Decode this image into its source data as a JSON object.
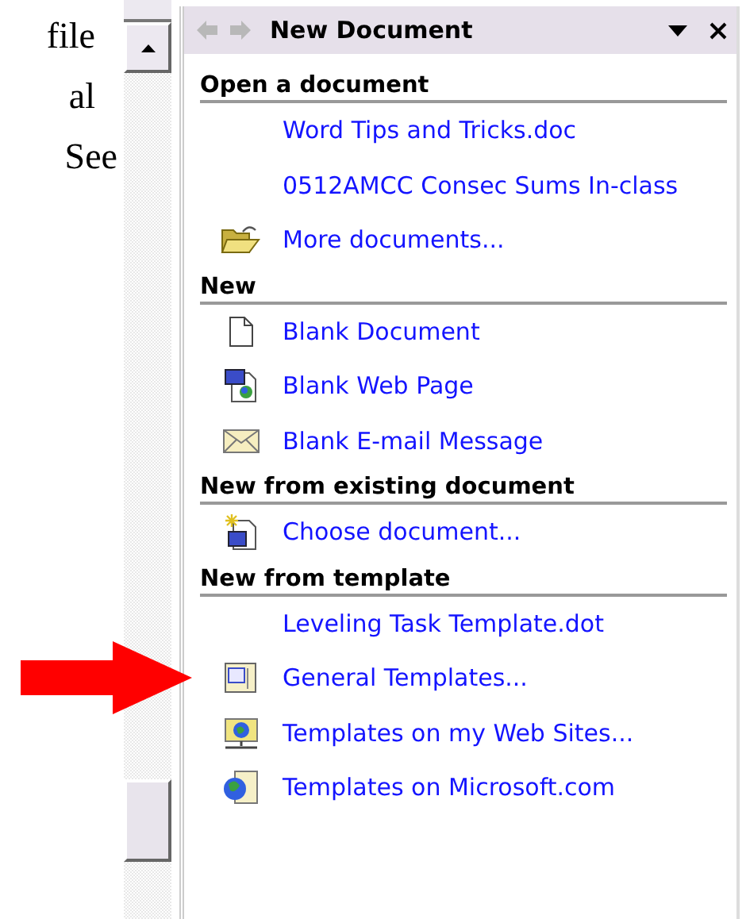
{
  "side_text": [
    "file",
    "al",
    "See"
  ],
  "pane": {
    "title": "New Document",
    "back_disabled": true,
    "forward_disabled": true,
    "sections": [
      {
        "heading": "Open a document",
        "items": [
          {
            "label": "Word Tips and Tricks.doc",
            "kind": "recent"
          },
          {
            "label": "0512AMCC Consec Sums In-class",
            "kind": "recent"
          },
          {
            "label": "More documents...",
            "kind": "folder"
          }
        ]
      },
      {
        "heading": "New",
        "items": [
          {
            "label": "Blank Document",
            "kind": "page"
          },
          {
            "label": "Blank Web Page",
            "kind": "webpage"
          },
          {
            "label": "Blank E-mail Message",
            "kind": "mail"
          }
        ]
      },
      {
        "heading": "New from existing document",
        "items": [
          {
            "label": "Choose document...",
            "kind": "choose"
          }
        ]
      },
      {
        "heading": "New from template",
        "items": [
          {
            "label": "Leveling Task Template.dot",
            "kind": "recent"
          },
          {
            "label": "General Templates...",
            "kind": "template",
            "pointed": true
          },
          {
            "label": "Templates on my Web Sites...",
            "kind": "websites"
          },
          {
            "label": "Templates on Microsoft.com",
            "kind": "globe"
          }
        ]
      }
    ]
  }
}
